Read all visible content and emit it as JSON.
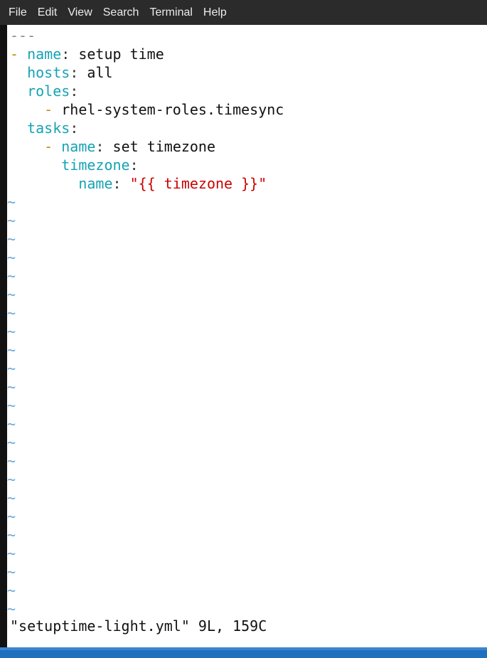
{
  "menu": {
    "items": [
      "File",
      "Edit",
      "View",
      "Search",
      "Terminal",
      "Help"
    ]
  },
  "editor": {
    "doc_start": "---",
    "lines": [
      {
        "indent": "",
        "dash": "- ",
        "key": "name",
        "value": " setup time",
        "str": ""
      },
      {
        "indent": "  ",
        "dash": "",
        "key": "hosts",
        "value": " all",
        "str": ""
      },
      {
        "indent": "  ",
        "dash": "",
        "key": "roles",
        "value": "",
        "str": ""
      },
      {
        "indent": "    ",
        "dash": "- ",
        "key": "",
        "value": "rhel-system-roles.timesync",
        "str": ""
      },
      {
        "indent": "  ",
        "dash": "",
        "key": "tasks",
        "value": "",
        "str": ""
      },
      {
        "indent": "    ",
        "dash": "- ",
        "key": "name",
        "value": " set timezone",
        "str": ""
      },
      {
        "indent": "      ",
        "dash": "",
        "key": "timezone",
        "value": "",
        "str": ""
      },
      {
        "indent": "        ",
        "dash": "",
        "key": "name",
        "value": " ",
        "str": "\"{{ timezone }}\""
      }
    ],
    "tilde": "~",
    "tilde_count": 23,
    "status": "\"setuptime-light.yml\" 9L, 159C"
  },
  "colors": {
    "key": "#16a3b4",
    "dash": "#c8860a",
    "string": "#cc0000",
    "tilde": "#6aa6d6"
  }
}
